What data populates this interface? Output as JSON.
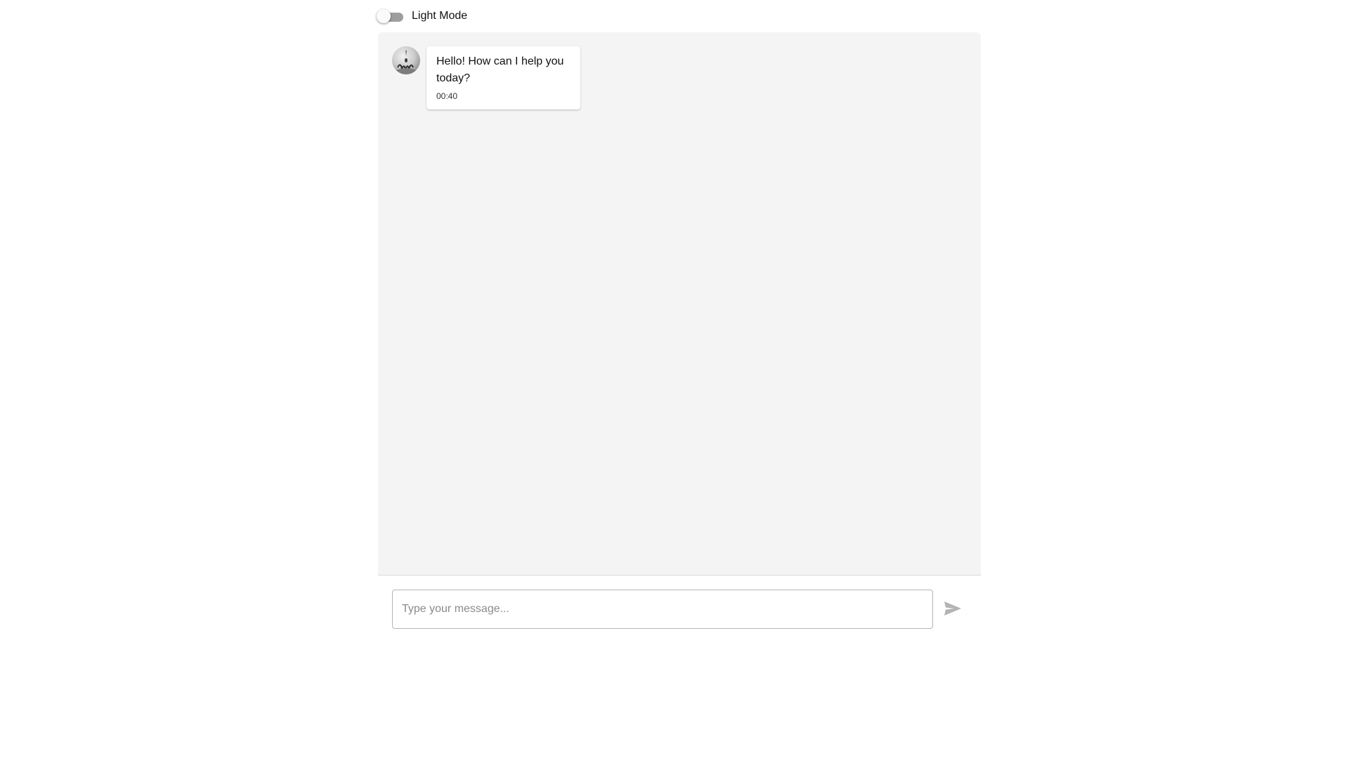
{
  "header": {
    "theme_toggle_label": "Light Mode"
  },
  "chat": {
    "messages": [
      {
        "sender": "bot",
        "text": "Hello! How can I help you today?",
        "time": "00:40"
      }
    ]
  },
  "composer": {
    "placeholder": "Type your message...",
    "value": ""
  },
  "colors": {
    "panel_bg": "#f4f4f4",
    "toggle_track": "#9e9e9e",
    "send_icon": "#b3b3b3"
  },
  "icons": {
    "avatar": "bot-avatar-icon",
    "send": "send-icon"
  }
}
